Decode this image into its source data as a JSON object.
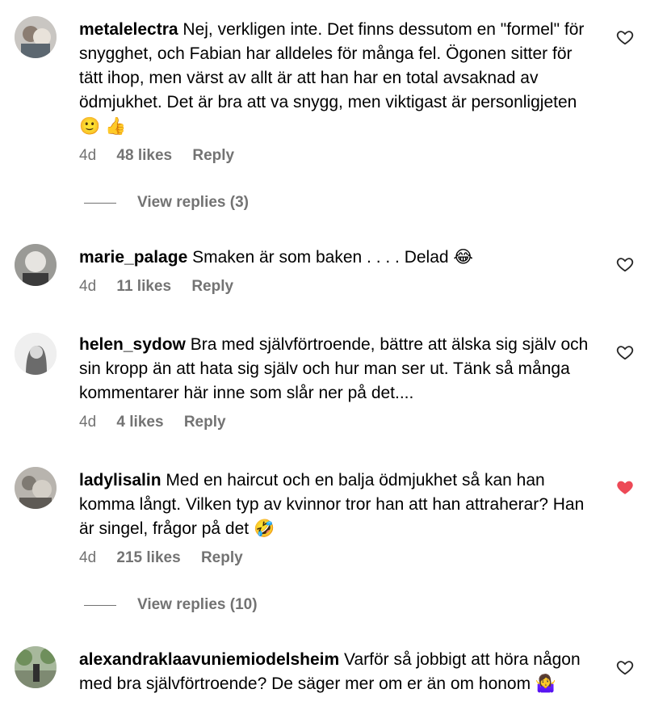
{
  "comments": [
    {
      "username": "metalelectra",
      "text": "Nej, verkligen inte. Det finns dessutom en \"formel\" för snygghet, och Fabian har alldeles för många fel. Ögonen sitter för tätt ihop, men värst av allt är att han har en total avsaknad av ödmjukhet. Det är bra att va snygg, men viktigast är personligjeten 🙂 👍",
      "time": "4d",
      "likes": "48 likes",
      "reply": "Reply",
      "view_replies": "View replies (3)",
      "liked": false
    },
    {
      "username": "marie_palage",
      "text": "Smaken är som baken . . . . Delad 😂",
      "time": "4d",
      "likes": "11 likes",
      "reply": "Reply",
      "liked": false
    },
    {
      "username": "helen_sydow",
      "text": "Bra med självförtroende, bättre att älska sig själv och sin kropp än att hata sig själv och hur man ser ut. Tänk så många kommentarer här inne som slår ner på det....",
      "time": "4d",
      "likes": "4 likes",
      "reply": "Reply",
      "liked": false
    },
    {
      "username": "ladylisalin",
      "text": "Med en haircut och en balja ödmjukhet så kan han komma långt. Vilken typ av kvinnor tror han att han attraherar? Han är singel, frågor på det 🤣",
      "time": "4d",
      "likes": "215 likes",
      "reply": "Reply",
      "view_replies": "View replies (10)",
      "liked": true
    },
    {
      "username": "alexandraklaavuniemiodelsheim",
      "text": "Varför så jobbigt att höra någon med bra självförtroende? De säger mer om er än om honom 🤷‍♀️",
      "liked": false
    }
  ],
  "colors": {
    "text": "#000000",
    "secondary": "#737373",
    "heart_liked": "#ed4956"
  },
  "icons": {
    "like": "heart-outline-icon",
    "liked": "heart-filled-icon"
  }
}
